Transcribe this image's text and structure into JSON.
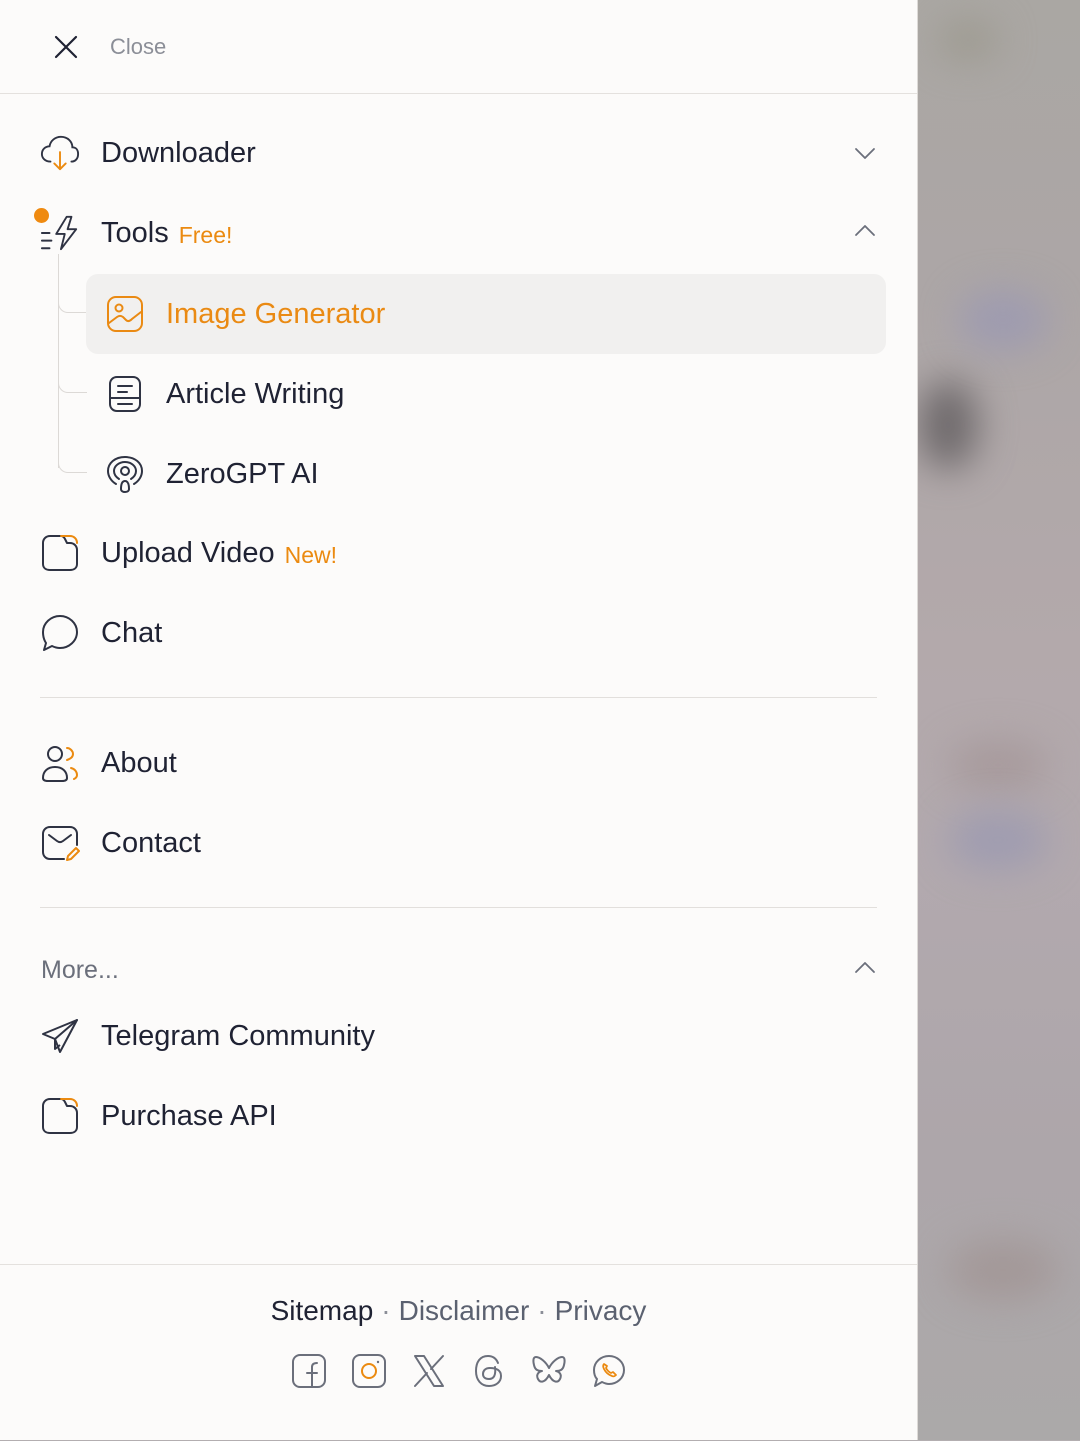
{
  "close": {
    "label": "Close"
  },
  "menu": {
    "downloader": {
      "label": "Downloader",
      "icon": "cloud-download-icon"
    },
    "tools": {
      "label": "Tools",
      "badge": "Free!",
      "icon": "flash-icon",
      "subitems": [
        {
          "label": "Image Generator",
          "icon": "image-icon",
          "active": true
        },
        {
          "label": "Article Writing",
          "icon": "document-icon"
        },
        {
          "label": "ZeroGPT AI",
          "icon": "ai-podcast-icon"
        }
      ]
    },
    "upload": {
      "label": "Upload Video",
      "badge": "New!",
      "icon": "folder-icon"
    },
    "chat": {
      "label": "Chat",
      "icon": "chat-bubble-icon"
    },
    "about": {
      "label": "About",
      "icon": "people-icon"
    },
    "contact": {
      "label": "Contact",
      "icon": "mail-edit-icon"
    }
  },
  "more": {
    "label": "More...",
    "items": [
      {
        "label": "Telegram Community",
        "icon": "send-icon"
      },
      {
        "label": "Purchase API",
        "icon": "folder-icon"
      }
    ]
  },
  "footer": {
    "links": [
      "Sitemap",
      "Disclaimer",
      "Privacy"
    ],
    "separator": "·",
    "socials": [
      "facebook-icon",
      "instagram-icon",
      "x-icon",
      "threads-icon",
      "bluesky-icon",
      "whatsapp-icon"
    ]
  },
  "colors": {
    "accent": "#EB8A10",
    "text": "#1F2233",
    "muted": "#8B8E97",
    "active_bg": "#F1F0EF"
  }
}
